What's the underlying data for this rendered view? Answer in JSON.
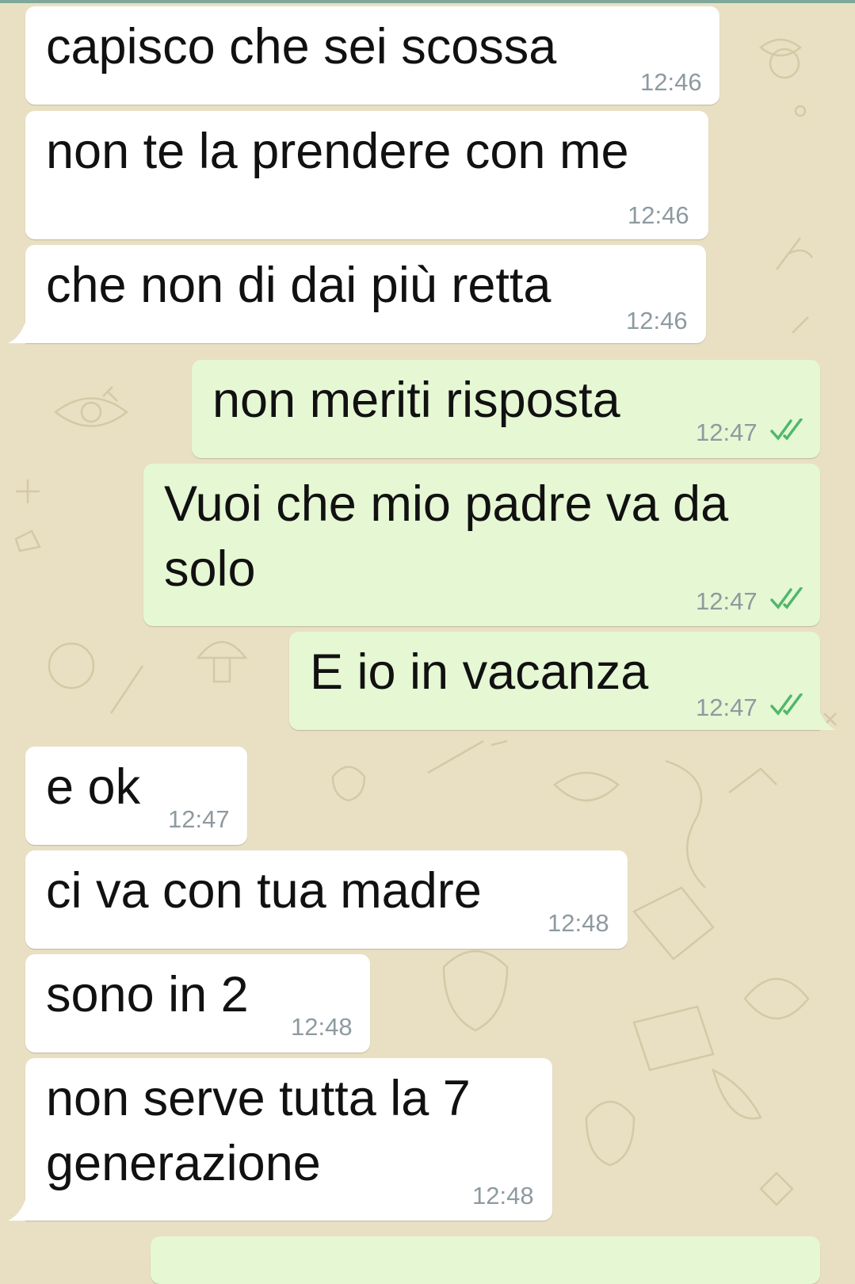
{
  "chat": {
    "messages": [
      {
        "direction": "in",
        "text": "capisco che sei scossa",
        "time": "12:46"
      },
      {
        "direction": "in",
        "text": "non te la prendere con me",
        "time": "12:46"
      },
      {
        "direction": "in",
        "text": "che non di dai più retta",
        "time": "12:46"
      },
      {
        "direction": "out",
        "text": "non meriti risposta",
        "time": "12:47",
        "status": "read-double-check"
      },
      {
        "direction": "out",
        "text": "Vuoi che mio padre va da",
        "text_line2": "solo",
        "time": "12:47",
        "status": "read-double-check"
      },
      {
        "direction": "out",
        "text": "E io in vacanza",
        "time": "12:47",
        "status": "read-double-check"
      },
      {
        "direction": "in",
        "text": "e ok",
        "time": "12:47"
      },
      {
        "direction": "in",
        "text": "ci va con tua madre",
        "time": "12:48"
      },
      {
        "direction": "in",
        "text": "sono in 2",
        "time": "12:48"
      },
      {
        "direction": "in",
        "text": "non serve tutta la 7",
        "text_line2": "generazione",
        "time": "12:48"
      }
    ]
  },
  "colors": {
    "wallpaper": "#e9e0c3",
    "incoming_bubble": "#ffffff",
    "outgoing_bubble": "#e6f7d4",
    "read_check": "#4fb86a",
    "timestamp": "#8e9a9f"
  },
  "icons": {
    "read_status": "double-check-icon"
  }
}
